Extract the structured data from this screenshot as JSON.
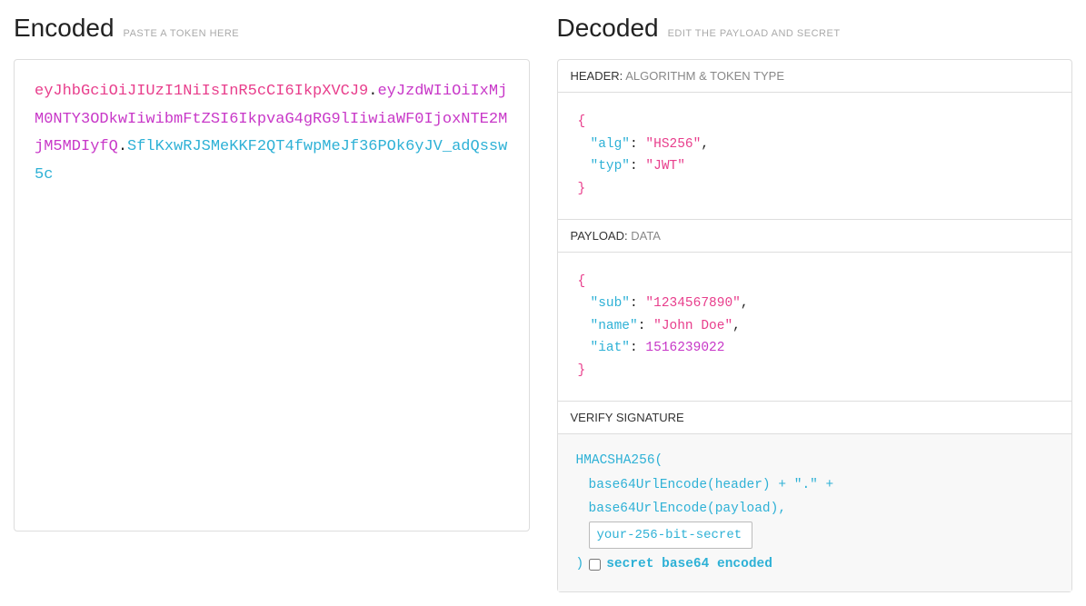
{
  "encoded": {
    "title": "Encoded",
    "hint": "PASTE A TOKEN HERE",
    "jwt": {
      "header": "eyJhbGciOiJIUzI1NiIsInR5cCI6IkpXVCJ9",
      "payload": "eyJzdWIiOiIxMjM0NTY3ODkwIiwibmFtZSI6IkpvaG4gRG9lIiwiaWF0IjoxNTE2MjM5MDIyfQ",
      "signature": "SflKxwRJSMeKKF2QT4fwpMeJf36POk6yJV_adQssw5c"
    }
  },
  "decoded": {
    "title": "Decoded",
    "hint": "EDIT THE PAYLOAD AND SECRET",
    "header_section": {
      "label": "HEADER:",
      "sub": "ALGORITHM & TOKEN TYPE",
      "fields": {
        "alg": "HS256",
        "typ": "JWT"
      }
    },
    "payload_section": {
      "label": "PAYLOAD:",
      "sub": "DATA",
      "fields": {
        "sub": "1234567890",
        "name": "John Doe",
        "iat": 1516239022
      }
    },
    "signature_section": {
      "label": "VERIFY SIGNATURE",
      "func": "HMACSHA256(",
      "line1": "base64UrlEncode(header) + \".\" +",
      "line2": "base64UrlEncode(payload),",
      "secret_placeholder": "your-256-bit-secret",
      "close": ")",
      "checkbox_label": "secret base64 encoded"
    }
  }
}
